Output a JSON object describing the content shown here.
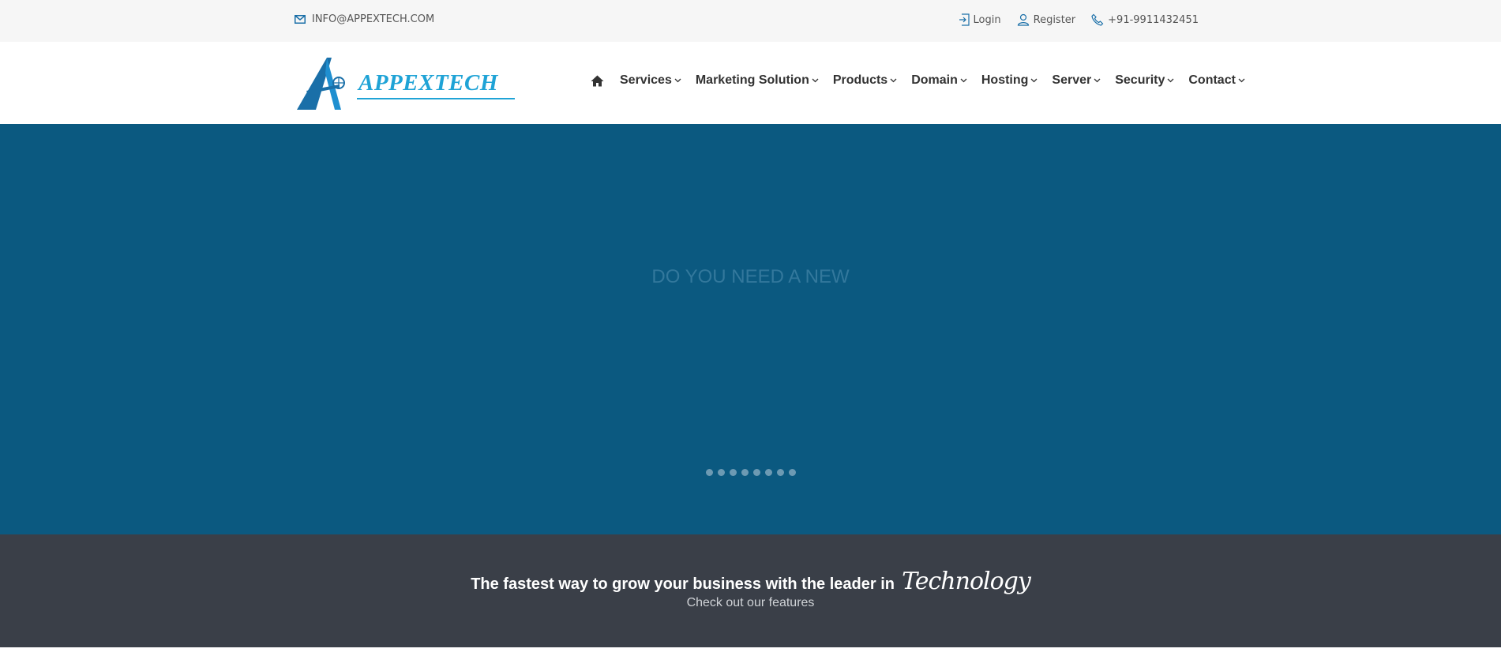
{
  "topbar": {
    "email": "INFO@APPEXTECH.COM",
    "login": "Login",
    "register": "Register",
    "phone": "+91-9911432451"
  },
  "header": {
    "logo_text": "APPEXTECH"
  },
  "nav": {
    "items": [
      "Services",
      "Marketing Solution",
      "Products",
      "Domain",
      "Hosting",
      "Server",
      "Security",
      "Contact"
    ]
  },
  "hero": {
    "headline": "DO YOU NEED A NEW",
    "slide_count": 8
  },
  "banner": {
    "lead": "The fastest way to grow your business with the leader in",
    "highlight": "Technology",
    "sub": "Check out our features"
  },
  "colors": {
    "brand": "#1fa3d6",
    "hero_bg": "#0b5980",
    "banner_bg": "#3a3f48",
    "topbar_bg": "#f6f6f6"
  },
  "icons": [
    "envelope-icon",
    "login-icon",
    "user-icon",
    "phone-icon",
    "home-icon",
    "chevron-down-icon"
  ]
}
